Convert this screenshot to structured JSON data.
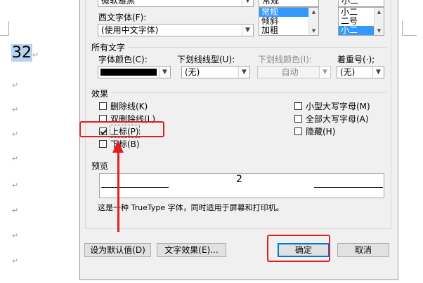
{
  "document": {
    "selected_text": "32",
    "paragraph_mark": "↵"
  },
  "dialog": {
    "top_combo_value": "微软雅黑",
    "style_list": {
      "items": [
        "常规",
        "倾斜",
        "加粗"
      ],
      "selected_index": 0
    },
    "size_list": {
      "items": [
        "小二",
        "二号",
        "小二"
      ],
      "selected_index": 2,
      "top_field": "小二"
    },
    "western_font": {
      "label": "西文字体(F):",
      "value": "(使用中文字体)"
    },
    "all_text": {
      "section_label": "所有文字",
      "font_color_label": "字体颜色(C):",
      "font_color_value": "#000000",
      "underline_type_label": "下划线线型(U):",
      "underline_type_value": "(无)",
      "underline_color_label": "下划线颜色(I):",
      "underline_color_value": "自动",
      "emphasis_label": "着重号(·);",
      "emphasis_value": "(无)"
    },
    "effects": {
      "section_label": "效果",
      "left": [
        {
          "label": "删除线(K)",
          "checked": false
        },
        {
          "label": "双删除线(L)",
          "checked": false
        },
        {
          "label": "上标(P)",
          "checked": true
        },
        {
          "label": "下标(B)",
          "checked": false
        }
      ],
      "right": [
        {
          "label": "小型大写字母(M)",
          "checked": false
        },
        {
          "label": "全部大写字母(A)",
          "checked": false
        },
        {
          "label": "隐藏(H)",
          "checked": false
        }
      ]
    },
    "preview": {
      "section_label": "预览",
      "sample": "2",
      "note": "这是一种 TrueType 字体，同时适用于屏幕和打印机。"
    },
    "buttons": {
      "set_default": "设为默认值(D)",
      "text_effects": "文字效果(E)...",
      "ok": "确定",
      "cancel": "取消"
    }
  },
  "annotation_color": "#e02020"
}
